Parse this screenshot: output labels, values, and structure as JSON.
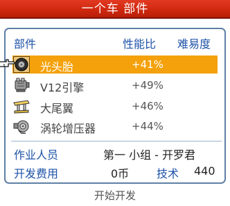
{
  "title": "一个车 部件",
  "table": {
    "headers": {
      "part": "部件",
      "ratio": "性能比",
      "difficulty": "难易度"
    },
    "rows": [
      {
        "name": "光头胎",
        "value": "+41%",
        "icon": "tire-icon",
        "selected": true
      },
      {
        "name": "V12引擎",
        "value": "+49%",
        "icon": "engine-icon",
        "selected": false
      },
      {
        "name": "大尾翼",
        "value": "+46%",
        "icon": "spoiler-icon",
        "selected": false
      },
      {
        "name": "涡轮增压器",
        "value": "+44%",
        "icon": "turbo-icon",
        "selected": false
      }
    ]
  },
  "info": {
    "staff_label": "作业人员",
    "staff_value": "第一 小组 - 开罗君",
    "cost_label": "开发费用",
    "cost_value": "0币",
    "tech_label": "技术",
    "tech_value": "440"
  },
  "footer": "开始开发",
  "colors": {
    "title_bar": "#d02910",
    "highlight": "#f4a10c",
    "label_blue": "#1d52a8",
    "panel_border": "#5f7fa6"
  }
}
